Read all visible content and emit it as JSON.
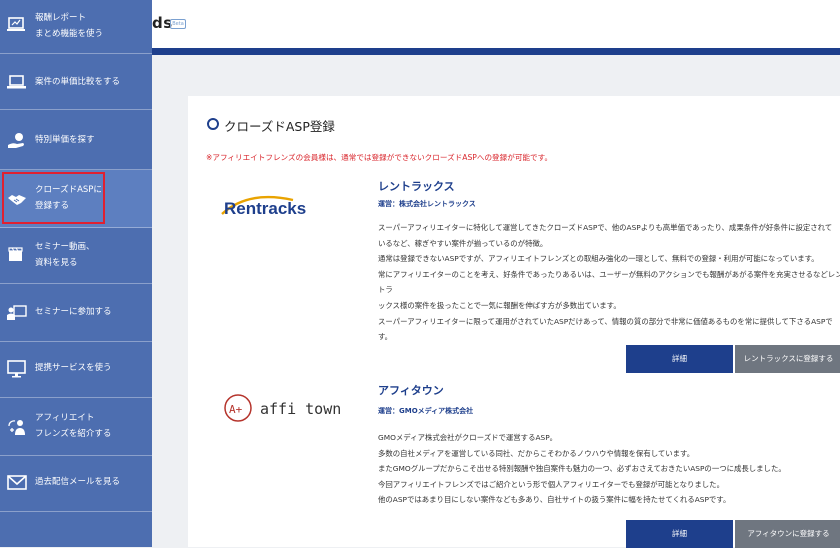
{
  "header": {
    "title_fragment": "ds",
    "badge": "Beta"
  },
  "sidebar": {
    "items": [
      {
        "label": "報酬レポート\nまとめ機能を使う",
        "icon": "report-icon"
      },
      {
        "label": "案件の単価比較をする",
        "icon": "laptop-icon"
      },
      {
        "label": "特別単価を探す",
        "icon": "hand-money-icon"
      },
      {
        "label": "クローズドASPに\n登録する",
        "icon": "handshake-icon"
      },
      {
        "label": "セミナー動画、\n資料を見る",
        "icon": "video-icon"
      },
      {
        "label": "セミナーに参加する",
        "icon": "seminar-icon"
      },
      {
        "label": "提携サービスを使う",
        "icon": "monitor-icon"
      },
      {
        "label": "アフィリエイト\nフレンズを紹介する",
        "icon": "users-icon"
      },
      {
        "label": "過去配信メールを見る",
        "icon": "mail-icon"
      }
    ]
  },
  "main": {
    "title": "クローズドASP登録",
    "notice": "※アフィリエイトフレンズの会員様は、通常では登録ができないクローズドASPへの登録が可能です。",
    "asps": [
      {
        "name": "レントラックス",
        "operator": "運営：株式会社レントラックス",
        "logo_text": "Rentracks",
        "description": "スーパーアフィリエイターに特化して運営してきたクローズドASPで、他のASPよりも高単価であったり、成果条件が好条件に設定されて\nいるなど、稼ぎやすい案件が揃っているのが特徴。\n通常は登録できないASPですが、アフィリエイトフレンズとの取組み強化の一環として、無料での登録・利用が可能になっています。\n常にアフィリエイターのことを考え、好条件であったりあるいは、ユーザーが無料のアクションでも報酬があがる案件を充実させるなどレントラ\nックス様の案件を扱ったことで一気に報酬を伸ばす方が多数出ています。\nスーパーアフィリエイターに限って運用がされていたASPだけあって、情報の質の部分で非常に価値あるものを常に提供して下さるASPで\nす。",
        "detail_label": "詳細",
        "register_label": "レントラックスに登録する"
      },
      {
        "name": "アフィタウン",
        "operator": "運営：GMOメディア株式会社",
        "logo_text": "affi town",
        "logo_badge": "A+",
        "description": "GMOメディア株式会社がクローズドで運営するASP。\n多数の自社メディアを運営している同社、だからこそわかるノウハウや情報を保有しています。\nまたGMOグループだからこそ出せる特別報酬や独自案件も魅力の一つ、必ずおさえておきたいASPの一つに成長しました。\n今回アフィリエイトフレンズではご紹介という形で個人アフィリエイターでも登録が可能となりました。\n他のASPではあまり目にしない案件なども多あり、自社サイトの扱う案件に幅を持たせてくれるASPです。",
        "detail_label": "詳細",
        "register_label": "アフィタウンに登録する"
      }
    ]
  },
  "colors": {
    "sidebar": "#4d6eb0",
    "brand": "#1e3f8c",
    "notice": "#d9262c",
    "highlight": "#e02030"
  }
}
